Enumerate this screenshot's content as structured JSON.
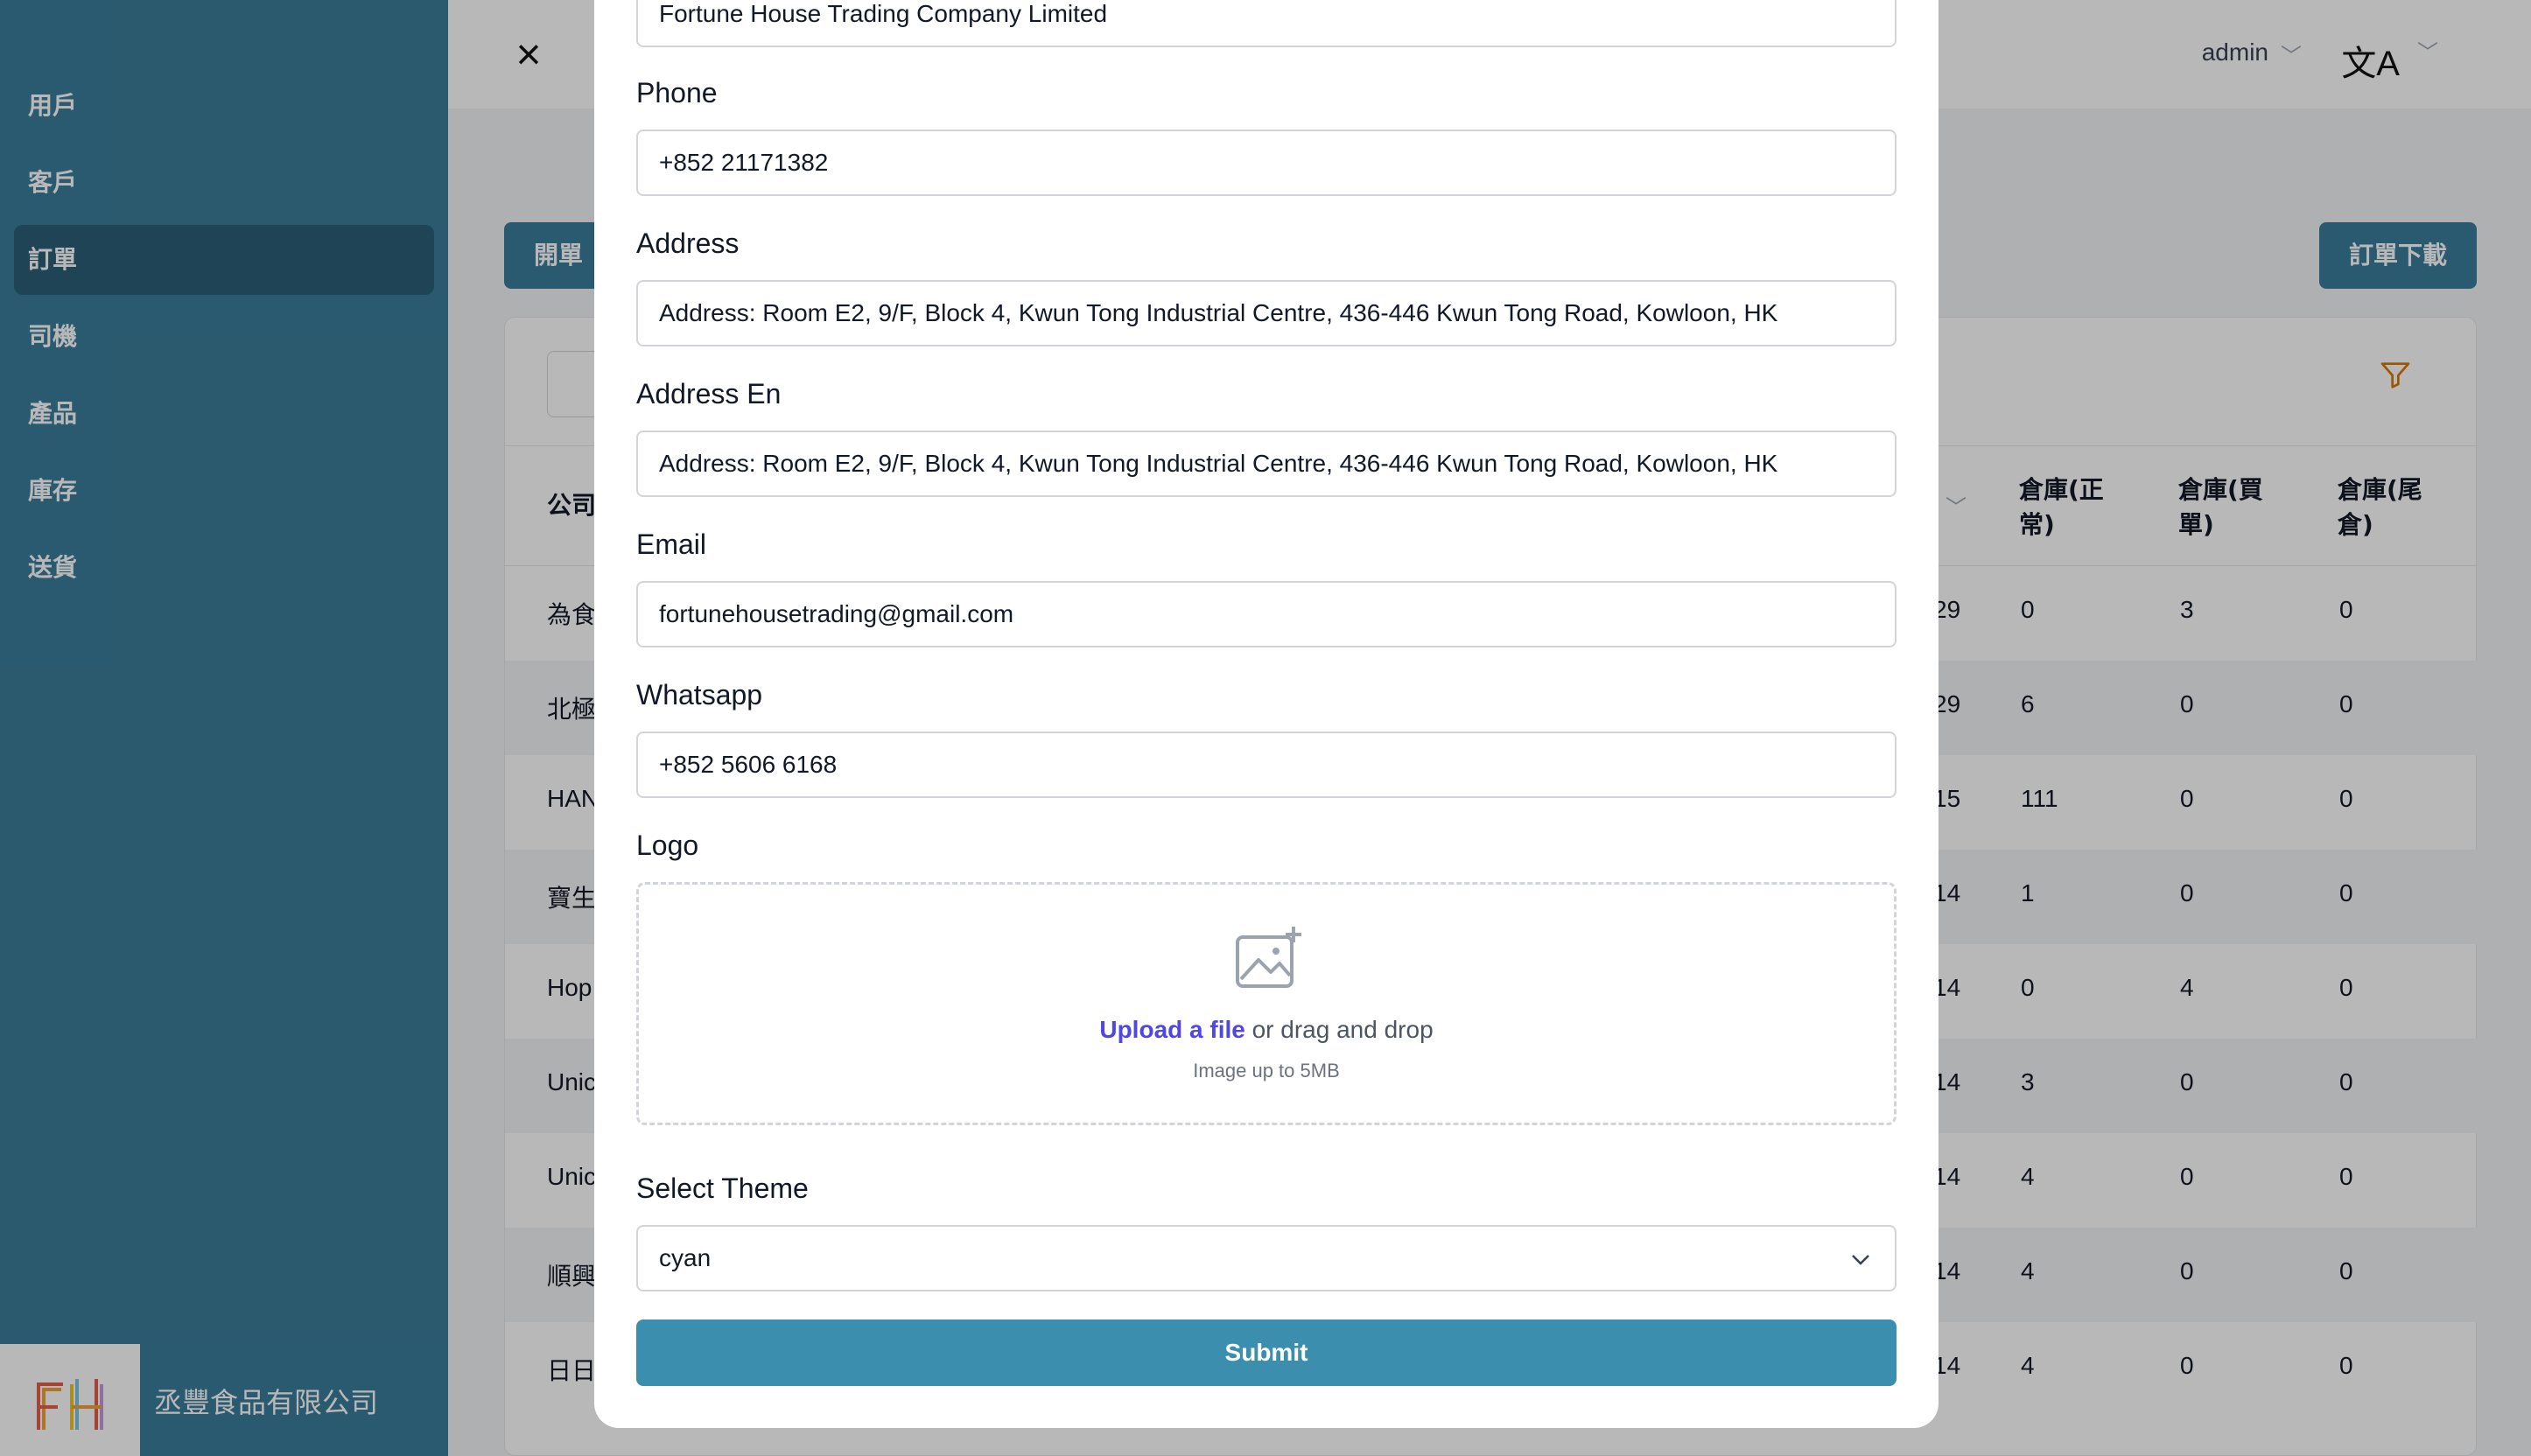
{
  "sidebar": {
    "items": [
      {
        "label": "用戶"
      },
      {
        "label": "客戶"
      },
      {
        "label": "訂單"
      },
      {
        "label": "司機"
      },
      {
        "label": "產品"
      },
      {
        "label": "庫存"
      },
      {
        "label": "送貨"
      }
    ],
    "active_index": 2,
    "brand_logo_text": "FH",
    "brand_name": "丞豐食品有限公司"
  },
  "header": {
    "close_icon": "×",
    "user": "admin",
    "language_icon": "文A"
  },
  "toolbar": {
    "open_order_label": "開單",
    "download_orders_label": "訂單下載"
  },
  "table": {
    "headers": [
      "公司",
      "倉庫(正常)",
      "倉庫(買單)",
      "倉庫(尾倉)"
    ],
    "rows": [
      {
        "company": "為食",
        "date": "29",
        "normal": "0",
        "bought": "3",
        "tail": "0"
      },
      {
        "company": "北極",
        "date": "29",
        "normal": "6",
        "bought": "0",
        "tail": "0"
      },
      {
        "company": "HAN",
        "date": "15",
        "normal": "111",
        "bought": "0",
        "tail": "0"
      },
      {
        "company": "寶生",
        "date": "14",
        "normal": "1",
        "bought": "0",
        "tail": "0"
      },
      {
        "company": "Hop",
        "date": "14",
        "normal": "0",
        "bought": "4",
        "tail": "0"
      },
      {
        "company": "Unic",
        "date": "14",
        "normal": "3",
        "bought": "0",
        "tail": "0"
      },
      {
        "company": "Unic",
        "date": "14",
        "normal": "4",
        "bought": "0",
        "tail": "0"
      },
      {
        "company": "順興",
        "date": "14",
        "normal": "4",
        "bought": "0",
        "tail": "0"
      },
      {
        "company": "日日",
        "date": "14",
        "normal": "4",
        "bought": "0",
        "tail": "0"
      }
    ]
  },
  "form": {
    "company_name_value": "Fortune House Trading Company Limited",
    "phone_label": "Phone",
    "phone_value": "+852 21171382",
    "address_label": "Address",
    "address_value": "Address: Room E2, 9/F, Block 4, Kwun Tong Industrial Centre, 436-446 Kwun Tong Road, Kowloon, HK",
    "address_en_label": "Address En",
    "address_en_value": "Address: Room E2, 9/F, Block 4, Kwun Tong Industrial Centre, 436-446 Kwun Tong Road, Kowloon, HK",
    "email_label": "Email",
    "email_value": "fortunehousetrading@gmail.com",
    "whatsapp_label": "Whatsapp",
    "whatsapp_value": "+852 5606 6168",
    "logo_label": "Logo",
    "upload_link": "Upload a file",
    "upload_text": " or drag and drop",
    "upload_hint": "Image up to 5MB",
    "theme_label": "Select Theme",
    "theme_value": "cyan",
    "submit_label": "Submit"
  },
  "colors": {
    "sidebar_bg": "#3b7d9a",
    "sidebar_active": "#2b5f77",
    "submit_bg": "#3b8ead",
    "link": "#4f46e5"
  }
}
